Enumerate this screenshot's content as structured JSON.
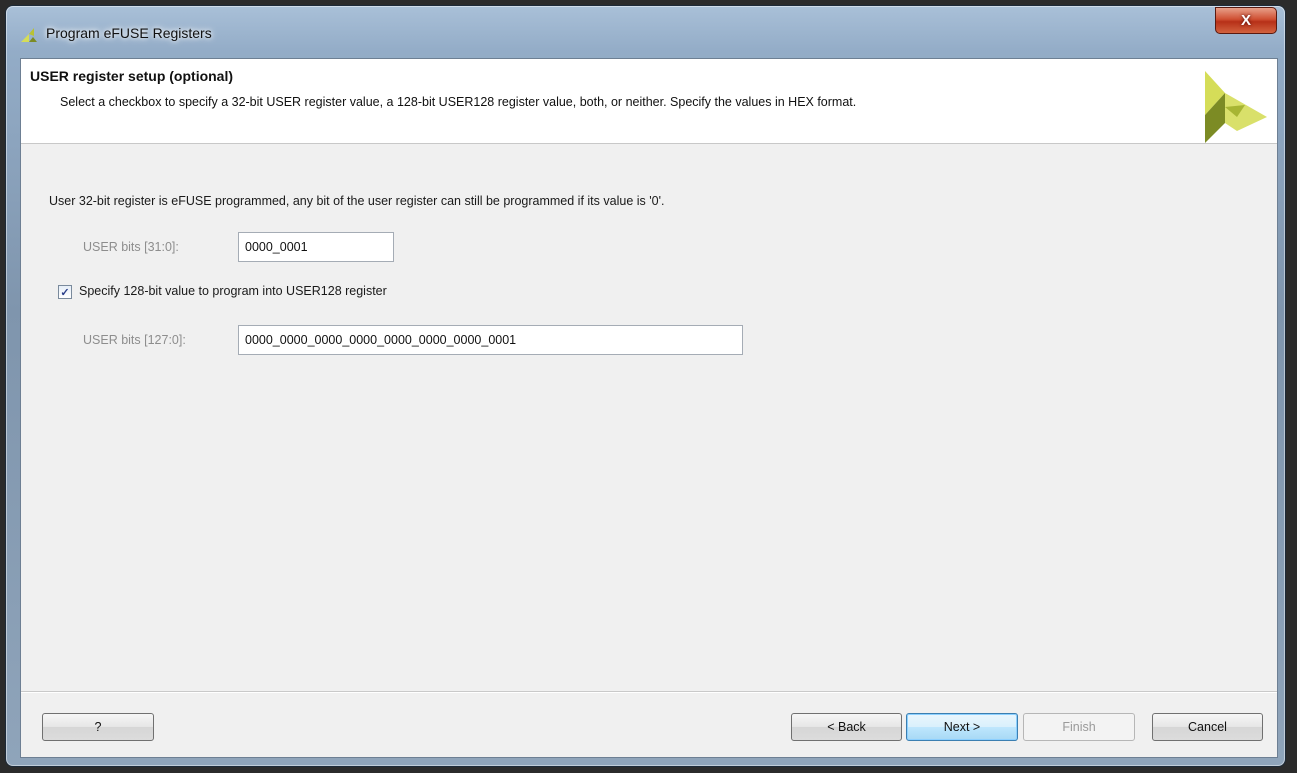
{
  "window": {
    "title": "Program eFUSE Registers",
    "close_label": "X"
  },
  "header": {
    "title": "USER register setup (optional)",
    "description": "Select a checkbox to specify a 32-bit USER register value, a 128-bit USER128 register value, both, or neither. Specify the values in HEX format."
  },
  "main": {
    "info_text": "User 32-bit register is eFUSE programmed, any bit of the user register can still be programmed if its value is '0'.",
    "user32": {
      "label": "USER bits [31:0]:",
      "value": "0000_0001"
    },
    "checkbox": {
      "label": "Specify 128-bit value to program into USER128 register",
      "checked": true
    },
    "user128": {
      "label": "USER bits [127:0]:",
      "value": "0000_0000_0000_0000_0000_0000_0000_0001"
    }
  },
  "footer": {
    "help_label": "?",
    "back_label": "< Back",
    "next_label": "Next >",
    "finish_label": "Finish",
    "cancel_label": "Cancel"
  },
  "colors": {
    "logo_dark": "#7c8b24",
    "logo_light": "#d5dd58",
    "logo_mid": "#a7b533"
  }
}
